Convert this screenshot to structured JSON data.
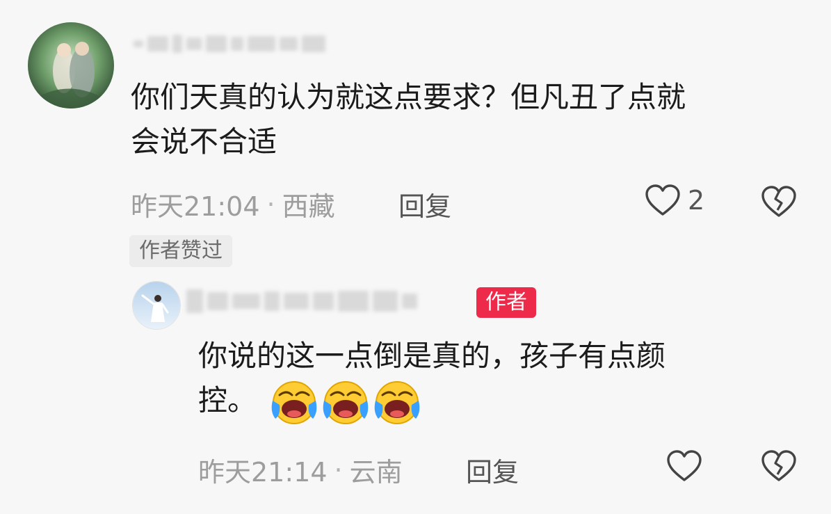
{
  "comments": [
    {
      "text_lines": [
        "你们天真的认为就这点要求？但凡丑了点就",
        "会说不合适"
      ],
      "time": "昨天21:04",
      "location": "西藏",
      "reply_label": "回复",
      "like_count": "2",
      "tag": "作者赞过"
    }
  ],
  "reply": {
    "author_badge": "作者",
    "text_lines": [
      "你说的这一点倒是真的，孩子有点颜",
      "控。"
    ],
    "emoji_names": [
      "laughing-crying-face-icon",
      "laughing-crying-face-icon",
      "laughing-crying-face-icon"
    ],
    "time": "昨天21:14",
    "location": "云南",
    "reply_label": "回复"
  },
  "colors": {
    "background": "#f7f7f7",
    "author_badge": "#ee2a4a",
    "meta_text": "#9d9d9d"
  }
}
